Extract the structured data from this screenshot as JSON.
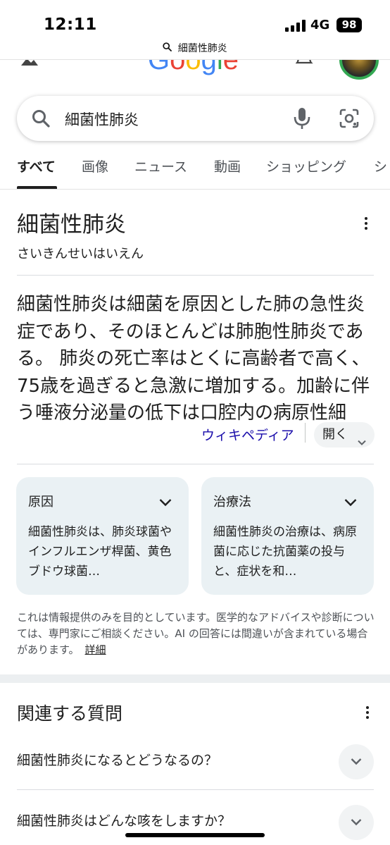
{
  "status_bar": {
    "time": "12:11",
    "network": "4G",
    "battery": "98"
  },
  "url_bar": {
    "text": "細菌性肺炎"
  },
  "header": {
    "logo_text": "Google"
  },
  "search": {
    "query": "細菌性肺炎"
  },
  "tabs": [
    {
      "label": "すべて",
      "active": true
    },
    {
      "label": "画像"
    },
    {
      "label": "ニュース"
    },
    {
      "label": "動画"
    },
    {
      "label": "ショッピング"
    },
    {
      "label": "シ"
    }
  ],
  "knowledge_panel": {
    "title": "細菌性肺炎",
    "reading": "さいきんせいはいえん",
    "description": "細菌性肺炎は細菌を原因とした肺の急性炎症であり、そのほとんどは肺胞性肺炎である。 肺炎の死亡率はとくに高齢者で高く、75歳を過ぎると急激に増加する。加齢に伴う唾液分泌量の低下は口腔内の病原性細",
    "source_link": "ウィキペディア",
    "open_button": "開く"
  },
  "cards": [
    {
      "title": "原因",
      "body": "細菌性肺炎は、肺炎球菌やインフルエンザ桿菌、黄色ブドウ球菌…"
    },
    {
      "title": "治療法",
      "body": "細菌性肺炎の治療は、病原菌に応じた抗菌薬の投与と、症状を和…"
    }
  ],
  "disclaimer": {
    "text": "これは情報提供のみを目的としています。医学的なアドバイスや診断については、専門家にご相談ください。AI の回答には間違いが含まれている場合があります。",
    "more_link": "詳細"
  },
  "related_questions": {
    "title": "関連する質問",
    "items": [
      "細菌性肺炎になるとどうなるの？",
      "細菌性肺炎はどんな咳をしますか？"
    ]
  },
  "colors": {
    "link": "#1a0dab",
    "card_bg": "#eaf1f4",
    "google_blue": "#4285f4",
    "google_red": "#ea4335",
    "google_yellow": "#fbbc05",
    "google_green": "#34a853"
  },
  "icons": [
    "search-icon",
    "mic-icon",
    "camera-icon",
    "menu-icon",
    "bell-icon",
    "chevron-down-icon",
    "more-vert-icon"
  ]
}
